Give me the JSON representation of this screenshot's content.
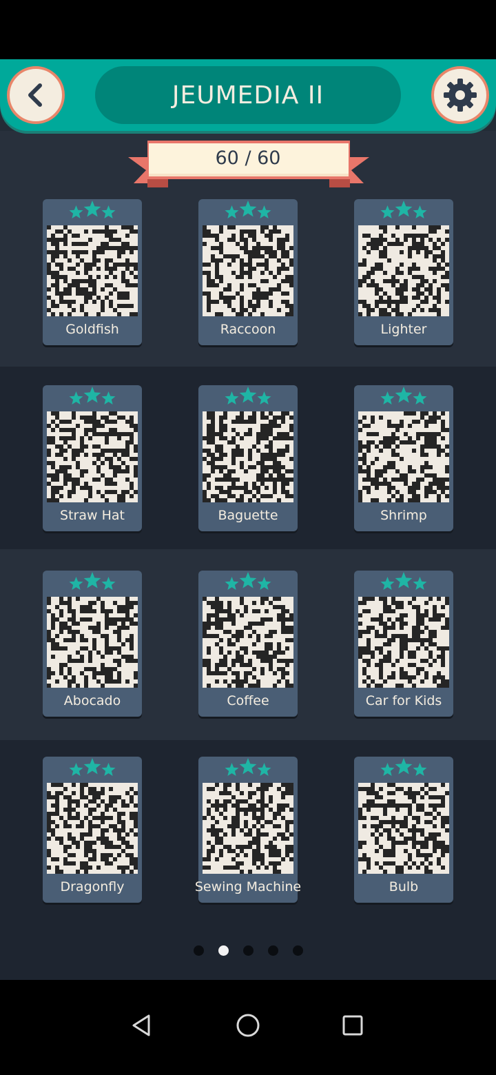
{
  "header": {
    "title": "JEUMEDIA II",
    "back_icon": "chevron-left-icon",
    "settings_icon": "gear-icon"
  },
  "progress": {
    "label": "60 / 60",
    "completed": 60,
    "total": 60
  },
  "colors": {
    "accent": "#00a99a",
    "accent_dark": "#008579",
    "star": "#1fb5a5",
    "card": "#4a5e75",
    "background": "#232c36",
    "ribbon": "#e8766a"
  },
  "puzzles": [
    {
      "label": "Goldfish",
      "stars": 3
    },
    {
      "label": "Raccoon",
      "stars": 3
    },
    {
      "label": "Lighter",
      "stars": 3
    },
    {
      "label": "Straw Hat",
      "stars": 3
    },
    {
      "label": "Baguette",
      "stars": 3
    },
    {
      "label": "Shrimp",
      "stars": 3
    },
    {
      "label": "Abocado",
      "stars": 3
    },
    {
      "label": "Coffee",
      "stars": 3
    },
    {
      "label": "Car for Kids",
      "stars": 3
    },
    {
      "label": "Dragonfly",
      "stars": 3
    },
    {
      "label": "Sewing Machine",
      "stars": 3
    },
    {
      "label": "Bulb",
      "stars": 3
    }
  ],
  "pager": {
    "page_count": 5,
    "current_page": 2
  },
  "nav": {
    "back_icon": "triangle-back-icon",
    "home_icon": "circle-home-icon",
    "recents_icon": "square-recents-icon"
  }
}
